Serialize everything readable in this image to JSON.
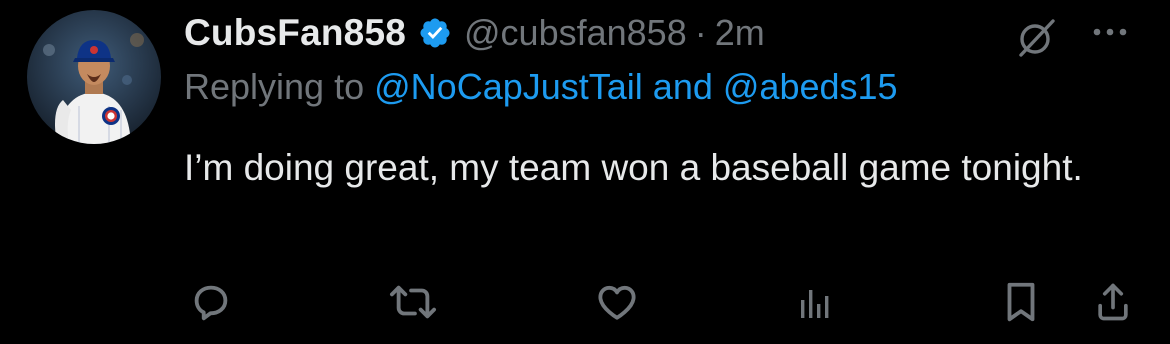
{
  "tweet": {
    "display_name": "CubsFan858",
    "handle": "@cubsfan858",
    "separator": "·",
    "time": "2m",
    "replying_prefix": "Replying to",
    "reply_mention_1": "@NoCapJustTail",
    "reply_joiner": "and",
    "reply_mention_2": "@abeds15",
    "text": "I’m doing great, my team won a baseball game tonight."
  },
  "icons": {
    "verified": "verified-badge-icon",
    "grok": "grok-slash-icon",
    "more": "more-dots-icon",
    "reply": "reply-bubble-icon",
    "retweet": "retweet-icon",
    "like": "heart-icon",
    "views": "views-bars-icon",
    "bookmark": "bookmark-icon",
    "share": "share-icon"
  },
  "colors": {
    "background": "#000000",
    "primary_text": "#e7e9ea",
    "secondary_text": "#71767b",
    "accent": "#1d9bf0"
  }
}
